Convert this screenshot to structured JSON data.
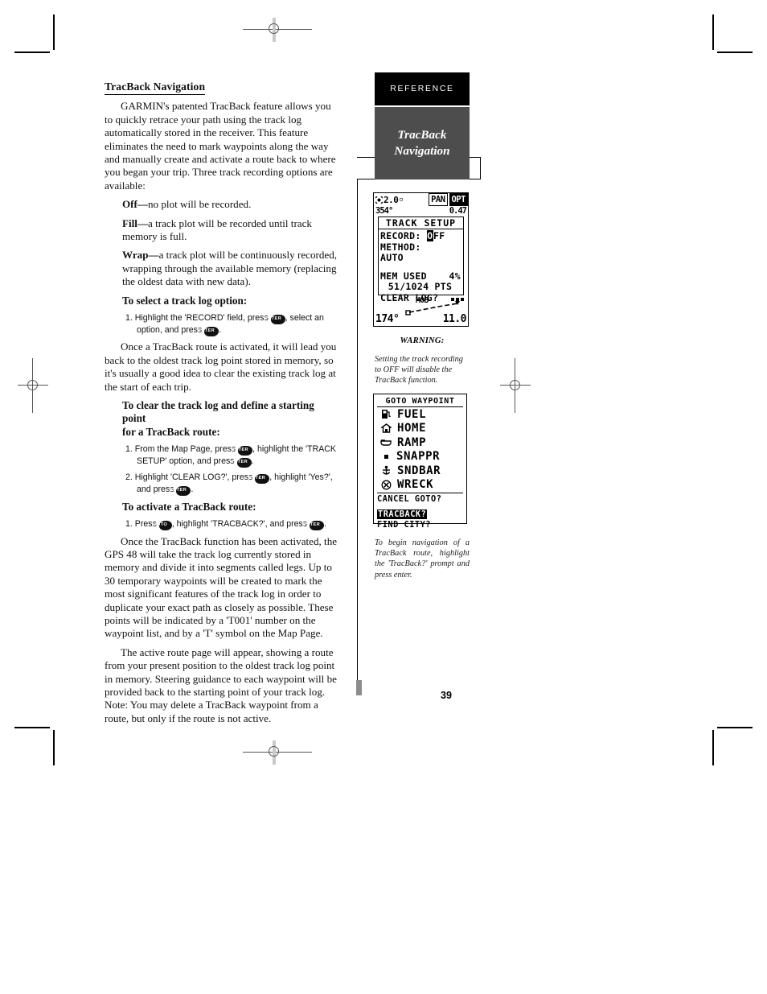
{
  "page": {
    "number": "39",
    "tab_label": "REFERENCE",
    "tab_sub_line1": "TracBack",
    "tab_sub_line2": "Navigation"
  },
  "article": {
    "title": "TracBack Navigation",
    "intro": "GARMIN's patented TracBack feature allows you to quickly retrace your path using the track log automatically stored in the receiver.  This feature eliminates the need to mark waypoints along the way and manually create and activate a route back to where you began your trip.  Three track recording options are available:",
    "options": [
      {
        "term": "Off—",
        "text": "no plot will be recorded."
      },
      {
        "term": "Fill—",
        "text": "a track plot will be recorded until track memory is full."
      },
      {
        "term": "Wrap—",
        "text": "a track plot will be continuously recorded, wrapping through the available memory (replacing the oldest data with new data)."
      }
    ],
    "proc1_heading": "To select a track log option:",
    "proc1_steps": [
      {
        "num": "1.",
        "parts": [
          "Highlight the 'RECORD' field, press ",
          "KEY:ENTER",
          ", select an option, and press ",
          "KEY:ENTER",
          "."
        ]
      }
    ],
    "para2": "Once a TracBack route is activated, it will lead you back to the oldest track log point stored in memory, so it's usually a good idea to clear the existing track log at the start of each trip.",
    "proc2_heading_line1": "To clear the track log and define a starting point",
    "proc2_heading_line2": "for a TracBack route:",
    "proc2_steps": [
      {
        "num": "1.",
        "parts": [
          "From the Map Page, press ",
          "KEY:ENTER",
          ", highlight the 'TRACK SETUP' option, and press ",
          "KEY:ENTER",
          "."
        ]
      },
      {
        "num": "2.",
        "parts": [
          "Highlight 'CLEAR LOG?', press ",
          "KEY:ENTER",
          ", highlight 'Yes?', and press ",
          "KEY:ENTER",
          "."
        ]
      }
    ],
    "proc3_heading": "To activate a TracBack route:",
    "proc3_steps": [
      {
        "num": "1.",
        "parts": [
          "Press ",
          "KEY:GOTO",
          ", highlight 'TRACBACK?', and press ",
          "KEY:ENTER",
          "."
        ]
      }
    ],
    "para3": "Once the TracBack function has been activated, the GPS 48 will take the track log currently stored in memory and divide it into segments called legs.  Up to 30 temporary waypoints will be created to mark the most significant features of the track log in order to duplicate your exact path as closely as possible.  These points will be indicated by a 'T001' number on the waypoint list, and by a 'T' symbol on the Map Page.",
    "para4": "The active route page will appear, showing a route from your present position to the oldest track log point in memory.  Steering guidance to each waypoint will be provided back to the starting point of your track log.  Note: You may delete a TracBack waypoint from a route, but only if the route is not active."
  },
  "keys": {
    "enter_label": "ENTER",
    "goto_label": "GOTO"
  },
  "figure_track_setup": {
    "zoom_value": "2.0",
    "zoom_unit": "ᴍ",
    "pan_label": "PAN",
    "opt_label": "OPT",
    "heading_left": "354°",
    "heading_right": "0.47",
    "window_title": "TRACK SETUP",
    "record_label": "RECORD: ",
    "record_value_first": "O",
    "record_value_rest": "FF",
    "method_label": "METHOD:",
    "method_value": "AUTO",
    "mem_label": "MEM USED",
    "mem_value": "4%",
    "pts_line": "51/1024 PTS",
    "clear_log": "CLEAR LOG?",
    "mob_label": "MOB",
    "bearing": "174°",
    "distance": "11.0"
  },
  "warning": {
    "heading": "WARNING:",
    "text": "Setting the track recording to OFF will disable the TracBack function."
  },
  "figure_goto_waypoint": {
    "title": "GOTO WAYPOINT",
    "waypoints": [
      {
        "icon": "fuel-pump-icon",
        "name": "FUEL"
      },
      {
        "icon": "house-icon",
        "name": "HOME"
      },
      {
        "icon": "boat-ramp-icon",
        "name": "RAMP"
      },
      {
        "icon": "small-square-icon",
        "name": "SNAPPR"
      },
      {
        "icon": "anchor-icon",
        "name": "SNDBAR"
      },
      {
        "icon": "circled-x-icon",
        "name": "WRECK"
      }
    ],
    "options": [
      {
        "label": "CANCEL GOTO?",
        "selected": false
      },
      {
        "label": "TRACBACK?",
        "selected": true
      },
      {
        "label": "FIND CITY?",
        "selected": false
      }
    ]
  },
  "figure_caption": "To begin navigation of a TracBack route, highlight the 'TracBack?' prompt and press enter."
}
